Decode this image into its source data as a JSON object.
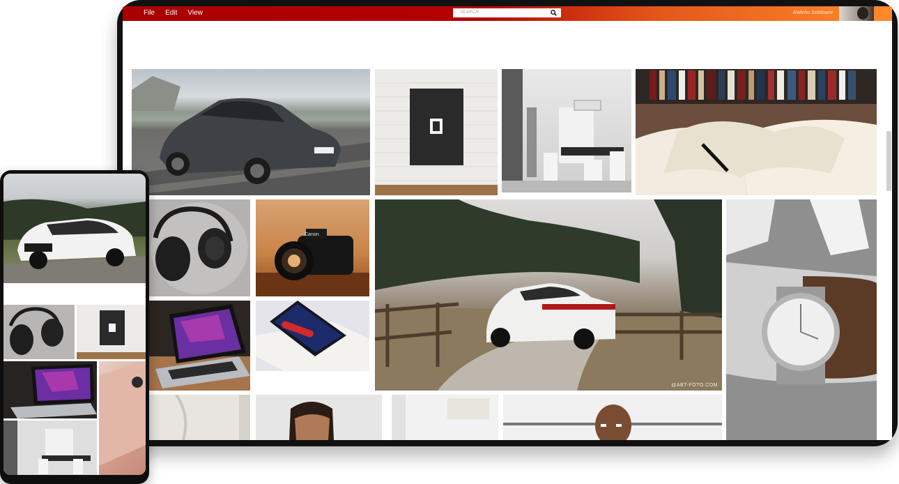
{
  "menu": {
    "file": "File",
    "edit": "Edit",
    "view": "View"
  },
  "search": {
    "placeholder": "SEARCH"
  },
  "user": {
    "name": "Ratleho Sebiloane"
  },
  "captions": {
    "suv_photo": "@ABT-FOTO.COM"
  },
  "photos": {
    "tablet": [
      "mercedes-coupe",
      "poster-frame",
      "dining-room",
      "open-book",
      "headphones",
      "canon-camera",
      "audi-suv-road",
      "wrist-watch",
      "laptop",
      "phone-on-box",
      "marble-wall",
      "man-portrait",
      "white-room",
      "bald-man"
    ],
    "phone": [
      "audi-suv",
      "headphones",
      "poster-frame",
      "laptop",
      "rose-gold-phone",
      "dining-room"
    ]
  },
  "colors": {
    "topbar_start": "#a80000",
    "topbar_end": "#ff8a2a",
    "device_frame": "#111111"
  }
}
